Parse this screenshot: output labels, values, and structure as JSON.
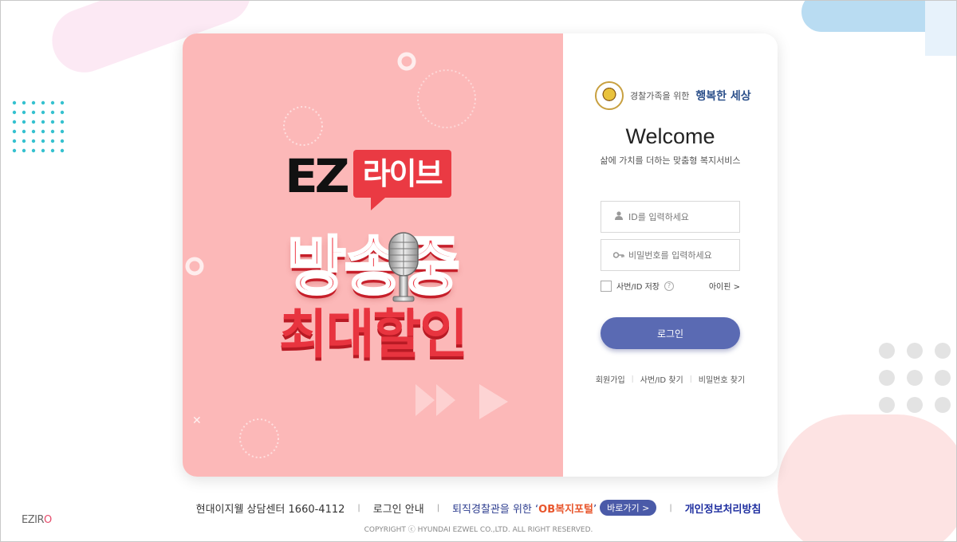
{
  "banner": {
    "ez": "EZ",
    "badge": "라이브",
    "line1": "방송중",
    "line2": "최대할인"
  },
  "brand": {
    "small": "경찰가족을 위한",
    "large": "행복한 세상"
  },
  "login": {
    "welcome": "Welcome",
    "subtitle": "삶에 가치를 더하는 맞춤형 복지서비스",
    "id_placeholder": "ID를 입력하세요",
    "pw_placeholder": "비밀번호를 입력하세요",
    "save_label": "사번/ID 저장",
    "help_glyph": "?",
    "ipin_label": "아이핀 >",
    "login_button": "로그인",
    "links": [
      "회원가입",
      "사번/ID 찾기",
      "비밀번호 찾기"
    ]
  },
  "footer": {
    "consult": "현대이지웰 상담센터 1660-4112",
    "login_guide": "로그인 안내",
    "ob_prefix": "퇴직경찰관을 위한 ‘",
    "ob_name": "OB복지포털",
    "ob_suffix": "’",
    "ob_button": "바로가기 >",
    "privacy": "개인정보처리방침",
    "copyright": "COPYRIGHT ⓒ HYUNDAI EZWEL CO.,LTD. ALL RIGHT RESERVED.",
    "separator": "|"
  },
  "logo": {
    "prefix": "EZIR",
    "suffix": "O"
  },
  "colors": {
    "banner_bg": "#fcb8b8",
    "banner_red": "#ef3d4a",
    "login_button": "#5a6ab3",
    "brand_blue": "#2b4f8a",
    "privacy_link": "#1f2fa0"
  }
}
